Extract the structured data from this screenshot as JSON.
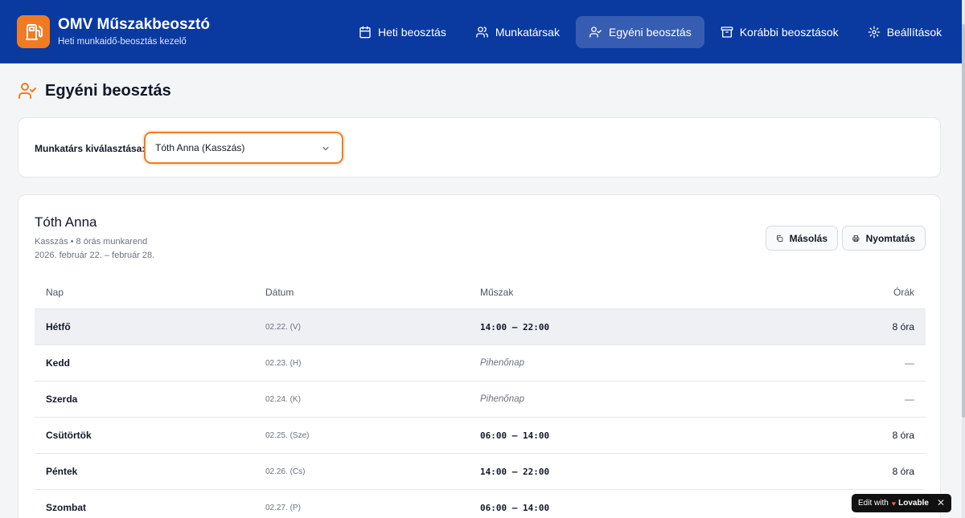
{
  "app": {
    "title": "OMV Műszakbeosztó",
    "subtitle": "Heti munkaidő-beosztás kezelő",
    "accent": "#f07b23",
    "header_bg": "#0a3aa0"
  },
  "nav": {
    "items": [
      {
        "label": "Heti beosztás",
        "icon": "calendar-icon"
      },
      {
        "label": "Munkatársak",
        "icon": "users-icon"
      },
      {
        "label": "Egyéni beosztás",
        "icon": "user-check-icon",
        "active": true
      },
      {
        "label": "Korábbi beosztások",
        "icon": "archive-icon"
      },
      {
        "label": "Beállítások",
        "icon": "gear-icon"
      }
    ]
  },
  "page": {
    "title": "Egyéni beosztás"
  },
  "selector": {
    "label": "Munkatárs kiválasztása:",
    "value": "Tóth Anna (Kasszás)"
  },
  "employee": {
    "name": "Tóth Anna",
    "meta": "Kasszás • 8 órás munkarend",
    "range": "2026. február 22. – február 28."
  },
  "actions": {
    "copy": "Másolás",
    "print": "Nyomtatás"
  },
  "table": {
    "headers": {
      "day": "Nap",
      "date": "Dátum",
      "shift": "Műszak",
      "hours": "Órák"
    },
    "rows": [
      {
        "day": "Hétfő",
        "date": "02.22. (V)",
        "shift": "14:00 – 22:00",
        "hours": "8 óra"
      },
      {
        "day": "Kedd",
        "date": "02.23. (H)",
        "shift": "Pihenőnap",
        "hours": "—"
      },
      {
        "day": "Szerda",
        "date": "02.24. (K)",
        "shift": "Pihenőnap",
        "hours": "—"
      },
      {
        "day": "Csütörtök",
        "date": "02.25. (Sze)",
        "shift": "06:00 – 14:00",
        "hours": "8 óra"
      },
      {
        "day": "Péntek",
        "date": "02.26. (Cs)",
        "shift": "14:00 – 22:00",
        "hours": "8 óra"
      },
      {
        "day": "Szombat",
        "date": "02.27. (P)",
        "shift": "06:00 – 14:00",
        "hours": ""
      }
    ]
  },
  "badge": {
    "prefix": "Edit with",
    "brand": "Lovable",
    "close": "✕"
  }
}
